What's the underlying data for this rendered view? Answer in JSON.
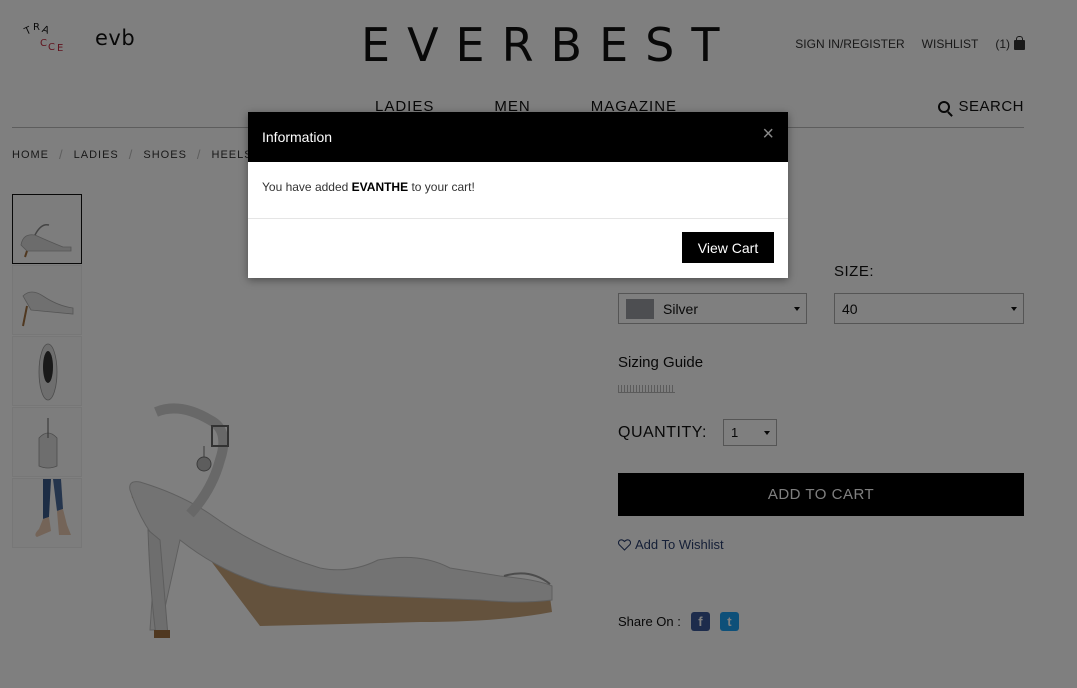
{
  "header": {
    "logo_tracce_letters": [
      "T",
      "R",
      "A",
      "C",
      "C",
      "E"
    ],
    "logo_evb": "evb",
    "brand": "EVERBEST",
    "sign_in": "SIGN IN/REGISTER",
    "wishlist": "WISHLIST",
    "cart_count": "(1)"
  },
  "nav": {
    "items": [
      "LADIES",
      "MEN",
      "MAGAZINE"
    ],
    "search": "SEARCH"
  },
  "breadcrumb": [
    "HOME",
    "LADIES",
    "SHOES",
    "HEELS"
  ],
  "breadcrumb_sep": "/",
  "product": {
    "size_label": "SIZE:",
    "color_value": "Silver",
    "color_swatch": "#9a9ca3",
    "size_value": "40",
    "sizing_guide": "Sizing Guide",
    "quantity_label": "QUANTITY:",
    "quantity_value": "1",
    "add_to_cart": "ADD TO CART",
    "add_to_wishlist": "Add To Wishlist",
    "share_label": "Share On :",
    "share_fb": "f",
    "share_tw": "t"
  },
  "modal": {
    "title": "Information",
    "close": "×",
    "message_prefix": "You have added ",
    "message_product": "EVANTHE",
    "message_suffix": " to your cart!",
    "view_cart": "View Cart"
  },
  "colors": {
    "accent": "#000000",
    "wishlist_link": "#2a3f6e",
    "facebook": "#3b5998",
    "twitter": "#1da1f2"
  }
}
